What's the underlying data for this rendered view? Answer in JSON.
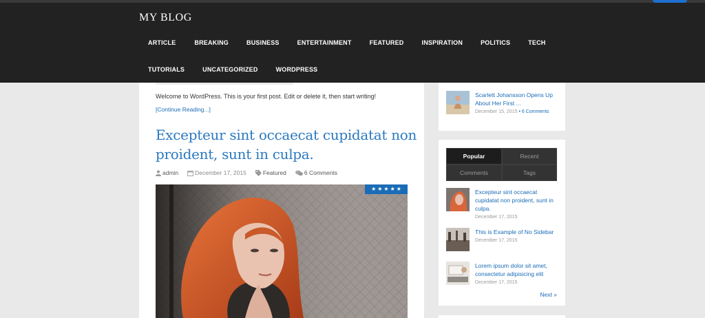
{
  "site": {
    "title": "MY BLOG"
  },
  "nav": {
    "row1": [
      "ARTICLE",
      "BREAKING",
      "BUSINESS",
      "ENTERTAINMENT",
      "FEATURED",
      "INSPIRATION",
      "POLITICS",
      "TECH"
    ],
    "row2": [
      "TUTORIALS",
      "UNCATEGORIZED",
      "WORDPRESS"
    ]
  },
  "main": {
    "excerpt": "Welcome to WordPress. This is your first post. Edit or delete it, then start writing!",
    "continue_label": "[Continue Reading...]",
    "post": {
      "title": "Excepteur sint occaecat cupidatat non proident, sunt in culpa.",
      "author": "admin",
      "date": "December 17, 2015",
      "category": "Featured",
      "comments": "6 Comments",
      "rating": 5
    }
  },
  "sidebar": {
    "top_post": {
      "title": "Scarlett Johansson Opens Up About Her First ...",
      "date": "December 15, 2015",
      "separator": "•",
      "comments": "6 Comments"
    },
    "tabs": [
      "Popular",
      "Recent",
      "Comments",
      "Tags"
    ],
    "active_tab": "Popular",
    "posts": [
      {
        "title": "Excepteur sint occaecat cupidatat non proident, sunt in culpa.",
        "date": "December 17, 2015"
      },
      {
        "title": "This is Example of No Sidebar",
        "date": "December 17, 2015"
      },
      {
        "title": "Lorem ipsum dolor sit amet, consectetur adipisicing elit",
        "date": "December 17, 2015"
      }
    ],
    "next_label": "Next »"
  },
  "colors": {
    "header_bg": "#222222",
    "link": "#1a6cb7",
    "title": "#2b79c0",
    "page_bg": "#e9e9e9"
  }
}
